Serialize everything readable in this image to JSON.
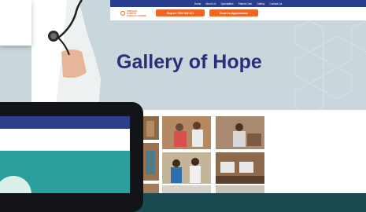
{
  "nav": {
    "items": [
      "Home",
      "About Us",
      "Specialities",
      "Patient Care",
      "Gallery",
      "Contact Us"
    ]
  },
  "logo": {
    "line1": "SHEKHAR HOSPITAL",
    "line2": "SURGICAL CENTRE"
  },
  "buttons": {
    "call": "Enquire 7000 000 401",
    "book": "Book An Appointment"
  },
  "hero": {
    "title": "Gallery of Hope"
  },
  "colors": {
    "nav": "#2a3e8f",
    "accent": "#f26522",
    "title": "#2a2f7a",
    "hero_bg": "#c9d6dc"
  },
  "gallery": {
    "photos": [
      "gallery-photo-1",
      "gallery-photo-2",
      "gallery-photo-3",
      "gallery-photo-4",
      "gallery-photo-5",
      "gallery-photo-6",
      "gallery-photo-7",
      "gallery-photo-8",
      "gallery-photo-9"
    ]
  }
}
